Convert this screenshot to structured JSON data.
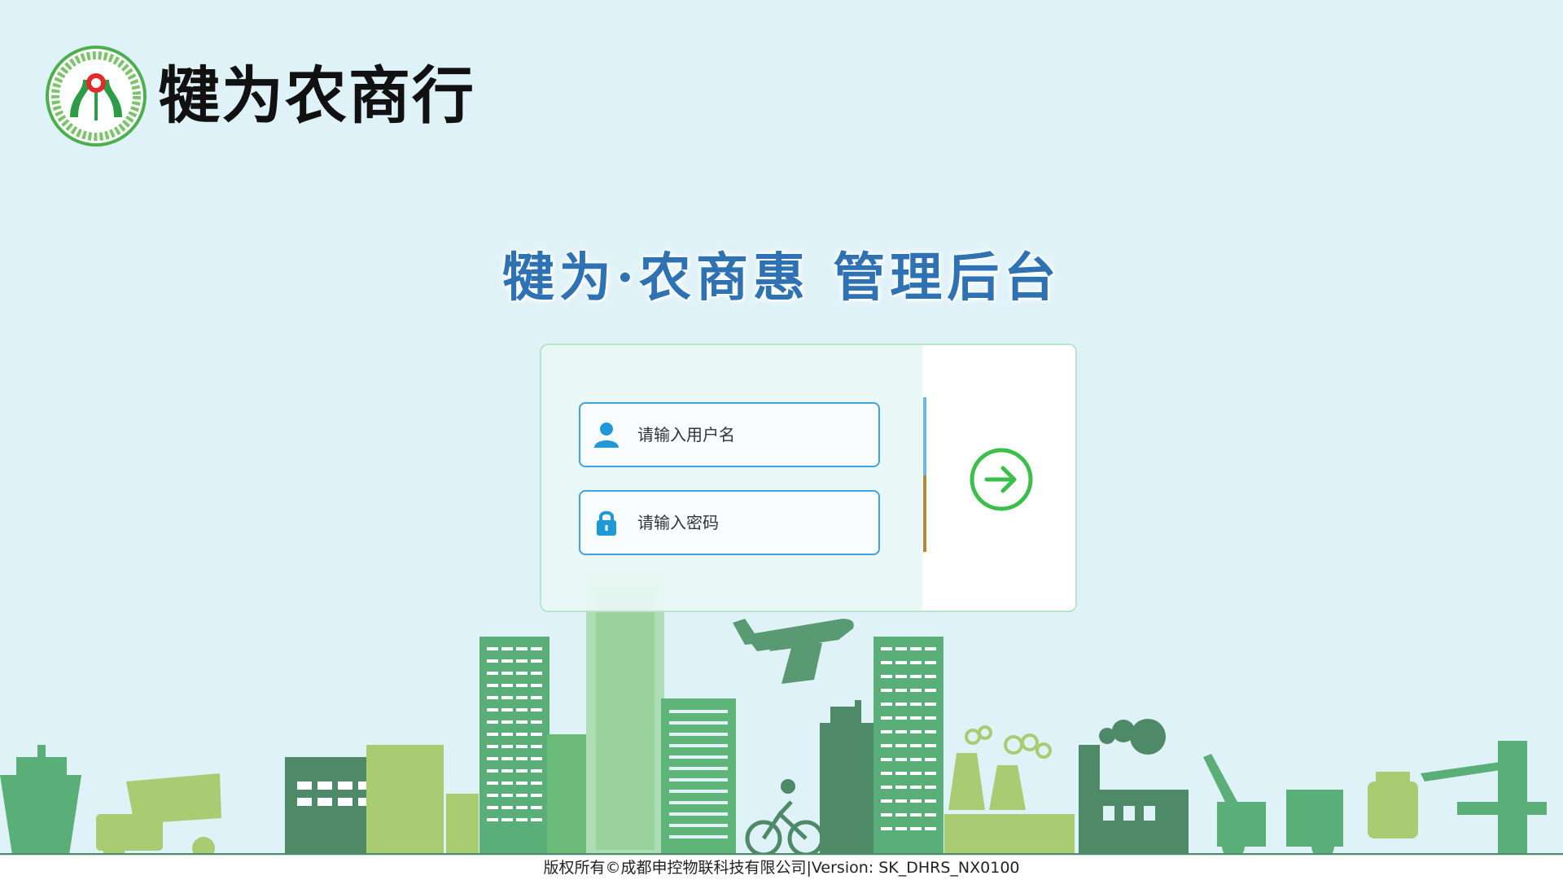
{
  "brand": {
    "logo_icon": "rcc-bank-logo-icon",
    "name": "犍为农商行"
  },
  "page": {
    "title": "犍为·农商惠 管理后台"
  },
  "login": {
    "username": {
      "placeholder": "请输入用户名",
      "icon": "user-icon",
      "value": ""
    },
    "password": {
      "placeholder": "请输入密码",
      "icon": "lock-icon",
      "value": ""
    },
    "submit_icon": "arrow-right-circle-icon"
  },
  "footer": {
    "copyright": "版权所有©成都申控物联科技有限公司|Version: SK_DHRS_NX0100"
  },
  "colors": {
    "background": "#dff2f8",
    "title": "#2f72b3",
    "input_border": "#3ea3dd",
    "submit_green": "#3cbf4a",
    "city_dark": "#5a9a72",
    "city_mid": "#6cbb78",
    "city_light": "#a9cc73"
  }
}
